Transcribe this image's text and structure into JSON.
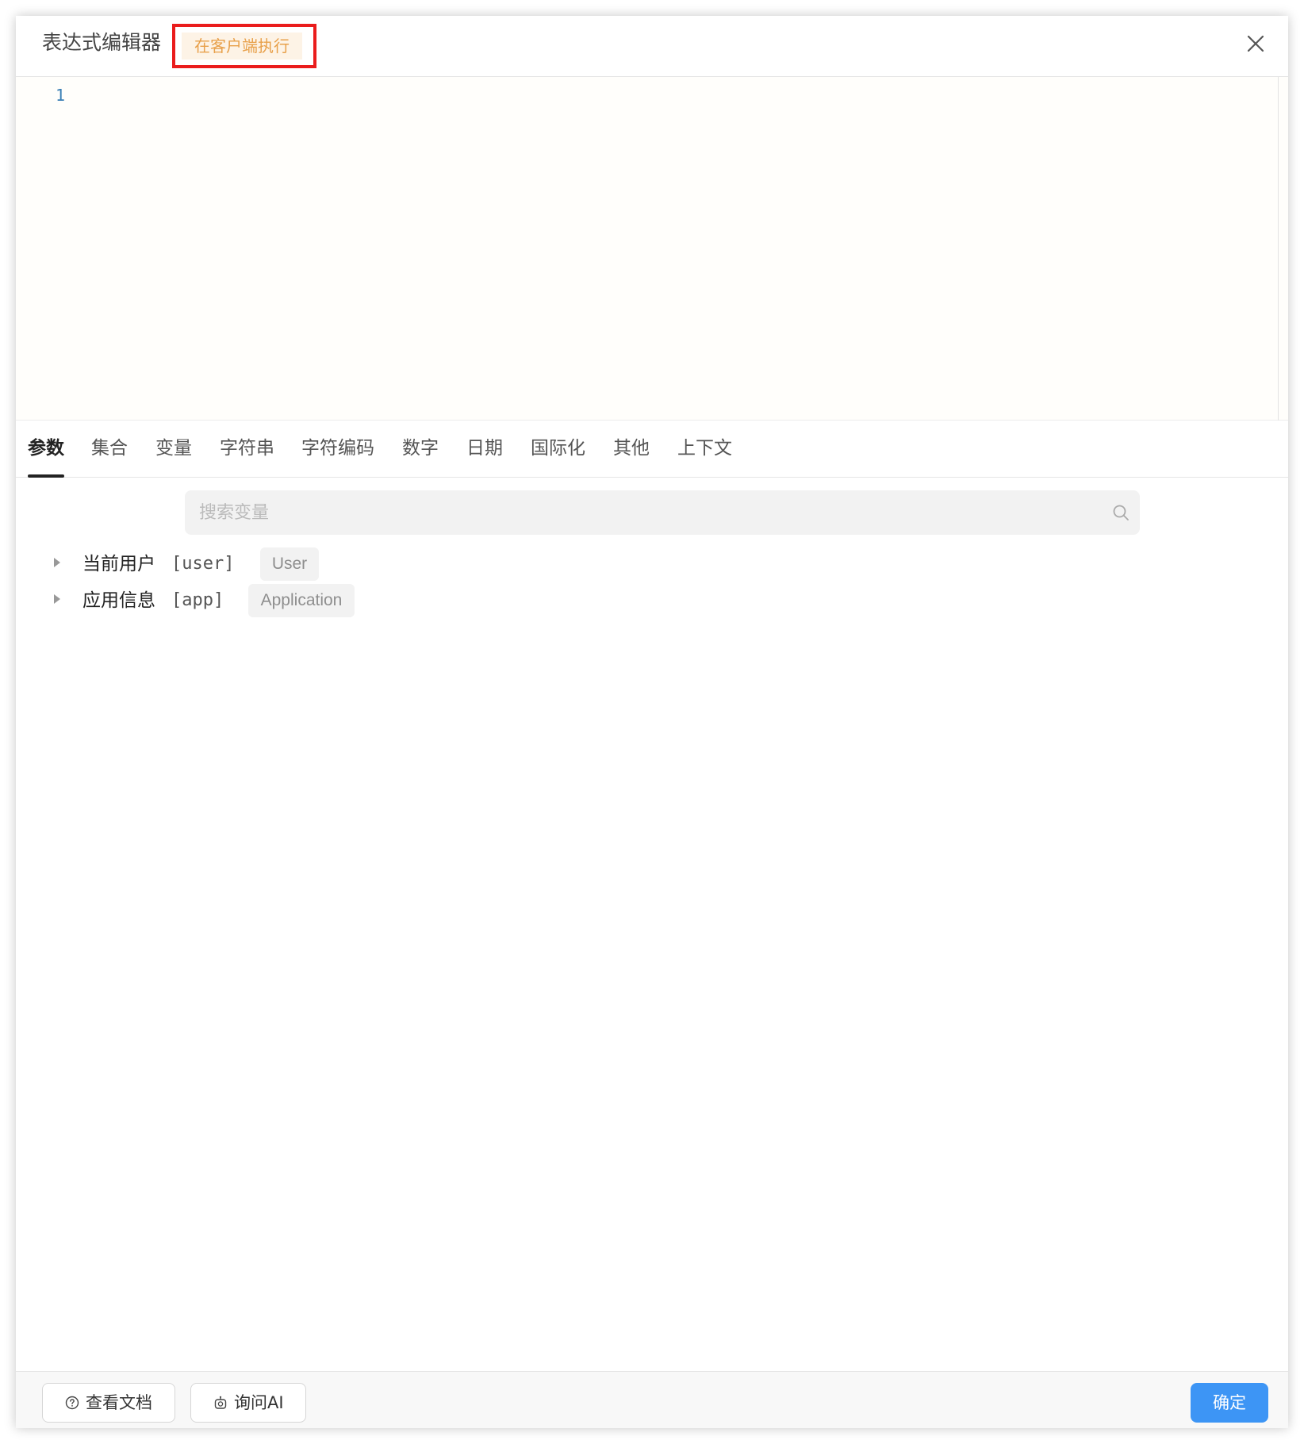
{
  "dialog": {
    "title": "表达式编辑器",
    "badge": "在客户端执行"
  },
  "editor": {
    "line_numbers": [
      "1"
    ]
  },
  "tabs": [
    {
      "label": "参数",
      "active": true
    },
    {
      "label": "集合",
      "active": false
    },
    {
      "label": "变量",
      "active": false
    },
    {
      "label": "字符串",
      "active": false
    },
    {
      "label": "字符编码",
      "active": false
    },
    {
      "label": "数字",
      "active": false
    },
    {
      "label": "日期",
      "active": false
    },
    {
      "label": "国际化",
      "active": false
    },
    {
      "label": "其他",
      "active": false
    },
    {
      "label": "上下文",
      "active": false
    }
  ],
  "search": {
    "placeholder": "搜索变量",
    "value": ""
  },
  "tree": [
    {
      "label": "当前用户",
      "key": "[user]",
      "type": "User"
    },
    {
      "label": "应用信息",
      "key": "[app]",
      "type": "Application"
    }
  ],
  "footer": {
    "docs_label": "查看文档",
    "ai_label": "询问AI",
    "confirm_label": "确定"
  },
  "colors": {
    "accent": "#3d95f5",
    "badge_text": "#e8a04a",
    "badge_bg": "#fdf3e6",
    "highlight_border": "#ea1c1c"
  },
  "icons": {
    "close": "close-icon",
    "search": "search-icon",
    "docs": "help-circle-icon",
    "ai": "robot-icon",
    "expand": "caret-right-icon"
  }
}
